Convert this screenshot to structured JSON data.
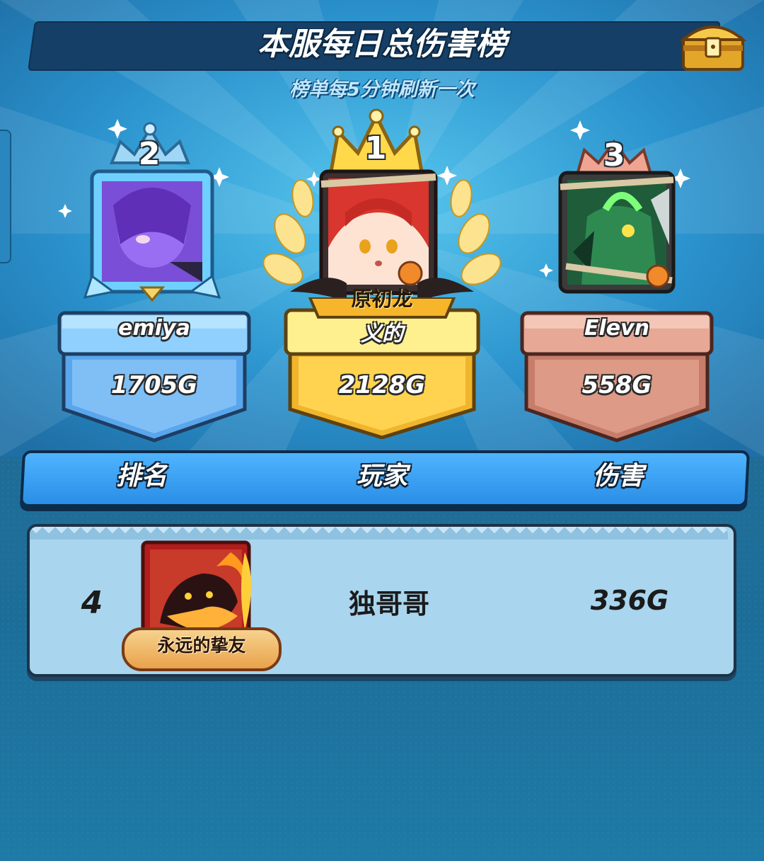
{
  "header": {
    "title": "本服每日总伤害榜",
    "subtitle": "榜单每5分钟刷新一次",
    "chest_icon": "treasure-chest-icon"
  },
  "podium": [
    {
      "place": "1",
      "name_line1": "原初龙",
      "name_line2": "义的",
      "score": "2128G",
      "color": "#f3c64a",
      "portrait": "red-haired-girl-avatar"
    },
    {
      "place": "2",
      "name": "emiya",
      "score": "1705G",
      "color": "#5db1f5",
      "portrait": "purple-haired-avatar"
    },
    {
      "place": "3",
      "name": "Elevn",
      "score": "558G",
      "color": "#d98a76",
      "portrait": "green-monster-avatar"
    }
  ],
  "table": {
    "col_rank": "排名",
    "col_player": "玩家",
    "col_damage": "伤害",
    "rows": [
      {
        "rank": "4",
        "player": "独哥哥",
        "damage": "336G",
        "avatar": "fire-dragon-avatar",
        "badge": "永远的挚友"
      }
    ]
  },
  "colors": {
    "background": "#1e7fb6",
    "header_bar": "#3ea2f7",
    "row_card": "#a9d5ee",
    "gold": "#f3c64a",
    "silver_blue": "#5db1f5",
    "bronze": "#d98a76"
  }
}
